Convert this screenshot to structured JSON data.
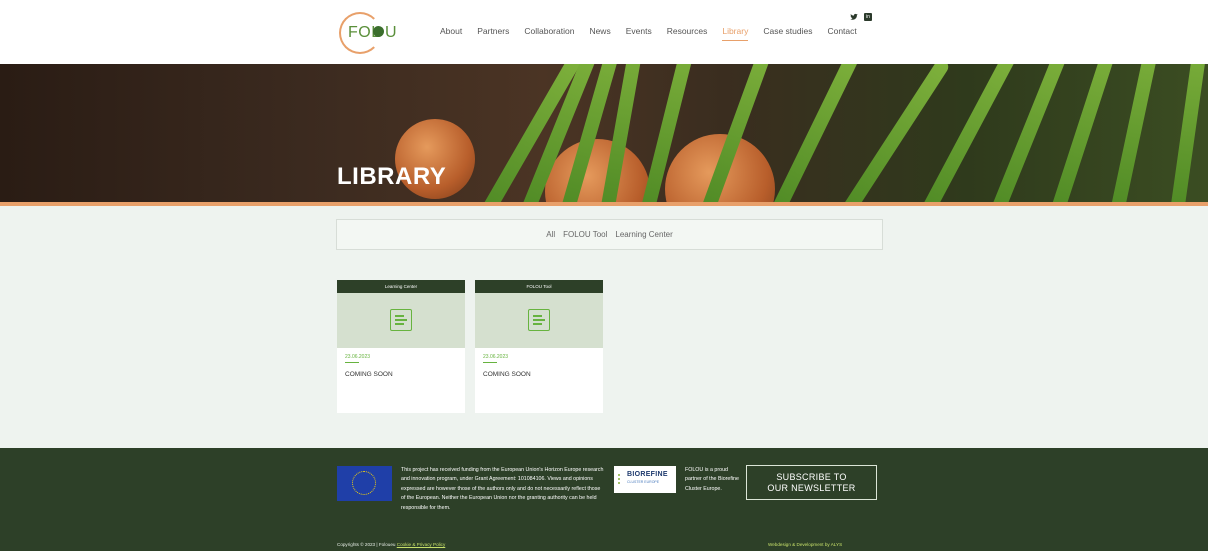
{
  "header": {
    "logo_text": "FOL  U",
    "nav": [
      "About",
      "Partners",
      "Collaboration",
      "News",
      "Events",
      "Resources",
      "Library",
      "Case studies",
      "Contact"
    ],
    "active_nav": "Library",
    "social": {
      "twitter_glyph": "🐦",
      "linkedin_glyph": "in"
    }
  },
  "hero": {
    "title": "LIBRARY"
  },
  "filter": {
    "items": [
      "All",
      "FOLOU Tool",
      "Learning Center"
    ]
  },
  "cards": [
    {
      "category": "Learning Center",
      "date": "23.06.2023",
      "title": "COMING SOON",
      "icon": "document-icon"
    },
    {
      "category": "FOLOU Tool",
      "date": "23.06.2023",
      "title": "COMING SOON",
      "icon": "document-icon"
    }
  ],
  "footer": {
    "eu_text": "This project has received funding from the European Union's Horizon Europe research and innovation program, under Grant Agreement: 101084106. Views and opinions expressed are however those of the authors only and do not necessarily reflect those of the European. Neither the European Union nor the granting authority can be held responsible for them.",
    "biorefine_main": "BIOREFINE",
    "biorefine_sub": "CLUSTER EUROPE",
    "bio_text": "FOLOU is a proud partner of the Biorefine Cluster Europe.",
    "subscribe_line1": "SUBSCRIBE TO",
    "subscribe_line2": "OUR NEWSLETTER",
    "copyright_prefix": "Copyrights © 2023 | Folouеu",
    "copyright_link": "Cookie & Privacy Policy",
    "credit": "Webdesign & Development by ALYS"
  },
  "colors": {
    "accent": "#e8a06a",
    "green": "#67b33f",
    "footer_bg": "#2d4028"
  }
}
